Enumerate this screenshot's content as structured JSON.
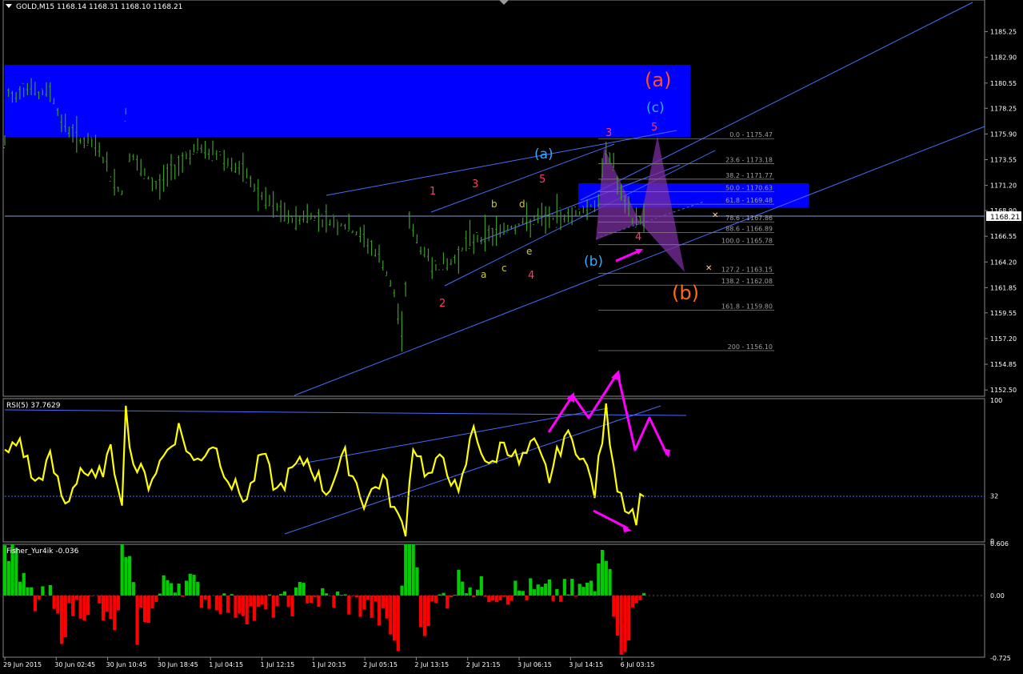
{
  "window": {
    "symbol_title": "GOLD,M15  1168.14 1168.31 1168.10 1168.21"
  },
  "colors": {
    "background": "#000000",
    "candle": "#3f9a2c",
    "zone": "#0000ff",
    "trendline": "#4a6bff",
    "rsi": "#ffff00",
    "fisher_up": "#00cc00",
    "fisher_down": "#ff0000",
    "fib": "#808080",
    "arrow": "#ff00ff",
    "harmonic": "#7a2ea0"
  },
  "chart_data": [
    {
      "type": "candlestick",
      "title": "GOLD,M15",
      "ohlc_last": {
        "open": 1168.14,
        "high": 1168.31,
        "low": 1168.1,
        "close": 1168.21
      },
      "current_price_label": "1168.21",
      "ylim": [
        1152.0,
        1188.0
      ],
      "y_ticks": [
        "1185.25",
        "1182.90",
        "1180.55",
        "1178.25",
        "1175.90",
        "1173.55",
        "1171.20",
        "1168.90",
        "1166.55",
        "1164.20",
        "1161.85",
        "1159.55",
        "1157.20",
        "1154.85",
        "1152.50"
      ],
      "x_ticks": [
        "29 Jun 2015",
        "30 Jun 02:45",
        "30 Jun 10:45",
        "30 Jun 18:45",
        "1 Jul 04:15",
        "1 Jul 12:15",
        "1 Jul 20:15",
        "2 Jul 05:15",
        "2 Jul 13:15",
        "2 Jul 21:15",
        "3 Jul 06:15",
        "3 Jul 14:15",
        "6 Jul 03:15"
      ],
      "path_points": [
        [
          0,
          1175
        ],
        [
          1,
          1179.4
        ],
        [
          2,
          1179.2
        ],
        [
          4,
          1180
        ],
        [
          7,
          1180.3
        ],
        [
          9,
          1179.3
        ],
        [
          12,
          1180
        ],
        [
          15,
          1177
        ],
        [
          18,
          1176
        ],
        [
          22,
          1175
        ],
        [
          25,
          1174.5
        ],
        [
          28,
          1172
        ],
        [
          31,
          1170.5
        ],
        [
          32,
          1178
        ],
        [
          33,
          1174
        ],
        [
          36,
          1172.5
        ],
        [
          40,
          1171
        ],
        [
          45,
          1173
        ],
        [
          50,
          1174.5
        ],
        [
          57,
          1174
        ],
        [
          64,
          1172
        ],
        [
          68,
          1170
        ],
        [
          72,
          1169
        ],
        [
          76,
          1168
        ],
        [
          80,
          1168.5
        ],
        [
          90,
          1167.5
        ],
        [
          96,
          1166
        ],
        [
          100,
          1164
        ],
        [
          103,
          1161
        ],
        [
          105,
          1158
        ],
        [
          106,
          1162
        ],
        [
          107,
          1168
        ],
        [
          109,
          1166
        ],
        [
          113,
          1164
        ],
        [
          118,
          1164
        ],
        [
          122,
          1166
        ],
        [
          130,
          1167
        ],
        [
          140,
          1168
        ],
        [
          150,
          1168.5
        ],
        [
          156,
          1169.5
        ],
        [
          157,
          1169.5
        ],
        [
          159,
          1175
        ],
        [
          161,
          1173
        ],
        [
          163,
          1170
        ],
        [
          166,
          1168
        ],
        [
          169,
          1168.2
        ]
      ],
      "fib_levels": [
        {
          "label": "0.0 - 1175.47",
          "value": 1175.47
        },
        {
          "label": "23.6 - 1173.18",
          "value": 1173.18
        },
        {
          "label": "38.2 - 1171.77",
          "value": 1171.77
        },
        {
          "label": "50.0 - 1170.63",
          "value": 1170.63
        },
        {
          "label": "61.8 - 1169.48",
          "value": 1169.48
        },
        {
          "label": "78.6 - 1167.86",
          "value": 1167.86
        },
        {
          "label": "88.6 - 1166.89",
          "value": 1166.89
        },
        {
          "label": "100.0 - 1165.78",
          "value": 1165.78
        },
        {
          "label": "127.2 - 1163.15",
          "value": 1163.15
        },
        {
          "label": "138.2 - 1162.08",
          "value": 1162.08
        },
        {
          "label": "161.8 - 1159.80",
          "value": 1159.8
        },
        {
          "label": "200 - 1156.10",
          "value": 1156.1
        }
      ],
      "wave_labels": [
        {
          "text": "(a)",
          "color": "#ff4f2a"
        },
        {
          "text": "(c)",
          "color": "#33a9ff"
        },
        {
          "text": "(a)",
          "color": "#33a9ff"
        },
        {
          "text": "(b)",
          "color": "#33a9ff"
        },
        {
          "text": "(b)",
          "color": "#ff6a1a"
        },
        {
          "text": "1",
          "color": "#ff3b6b"
        },
        {
          "text": "2",
          "color": "#ff3b6b"
        },
        {
          "text": "3",
          "color": "#ff3b6b"
        },
        {
          "text": "4",
          "color": "#ff3b6b"
        },
        {
          "text": "5",
          "color": "#ff3b6b"
        },
        {
          "text": "3",
          "color": "#ff3b6b"
        },
        {
          "text": "4",
          "color": "#ff3b6b"
        },
        {
          "text": "5",
          "color": "#ff3b6b"
        },
        {
          "text": "a",
          "color": "#c8c84a"
        },
        {
          "text": "b",
          "color": "#c8c84a"
        },
        {
          "text": "c",
          "color": "#c8c84a"
        },
        {
          "text": "d",
          "color": "#c8c84a"
        },
        {
          "text": "e",
          "color": "#c8c84a"
        }
      ]
    },
    {
      "type": "line",
      "title": "RSI(5) 37.7629",
      "ylim": [
        0,
        100
      ],
      "y_ticks": [
        "100",
        "32",
        "0"
      ],
      "level": 32,
      "path_points": [
        [
          0,
          60
        ],
        [
          4,
          72
        ],
        [
          8,
          40
        ],
        [
          12,
          58
        ],
        [
          16,
          25
        ],
        [
          20,
          52
        ],
        [
          24,
          42
        ],
        [
          28,
          62
        ],
        [
          31,
          32
        ],
        [
          32,
          92
        ],
        [
          34,
          55
        ],
        [
          38,
          42
        ],
        [
          42,
          60
        ],
        [
          46,
          80
        ],
        [
          50,
          55
        ],
        [
          55,
          70
        ],
        [
          60,
          40
        ],
        [
          64,
          30
        ],
        [
          68,
          62
        ],
        [
          72,
          35
        ],
        [
          76,
          50
        ],
        [
          80,
          58
        ],
        [
          85,
          35
        ],
        [
          90,
          60
        ],
        [
          95,
          28
        ],
        [
          100,
          45
        ],
        [
          104,
          15
        ],
        [
          106,
          10
        ],
        [
          108,
          70
        ],
        [
          112,
          45
        ],
        [
          116,
          60
        ],
        [
          120,
          30
        ],
        [
          124,
          82
        ],
        [
          128,
          50
        ],
        [
          132,
          72
        ],
        [
          136,
          55
        ],
        [
          140,
          68
        ],
        [
          144,
          45
        ],
        [
          148,
          75
        ],
        [
          152,
          65
        ],
        [
          156,
          35
        ],
        [
          159,
          92
        ],
        [
          162,
          40
        ],
        [
          165,
          22
        ],
        [
          167,
          18
        ],
        [
          169,
          38
        ]
      ]
    },
    {
      "type": "bar",
      "title": "Fisher_Yur4ik -0.036",
      "ylim": [
        -0.725,
        0.606
      ],
      "y_ticks": [
        "0.606",
        "0.00",
        "-0.725"
      ],
      "zero_line": true
    }
  ]
}
